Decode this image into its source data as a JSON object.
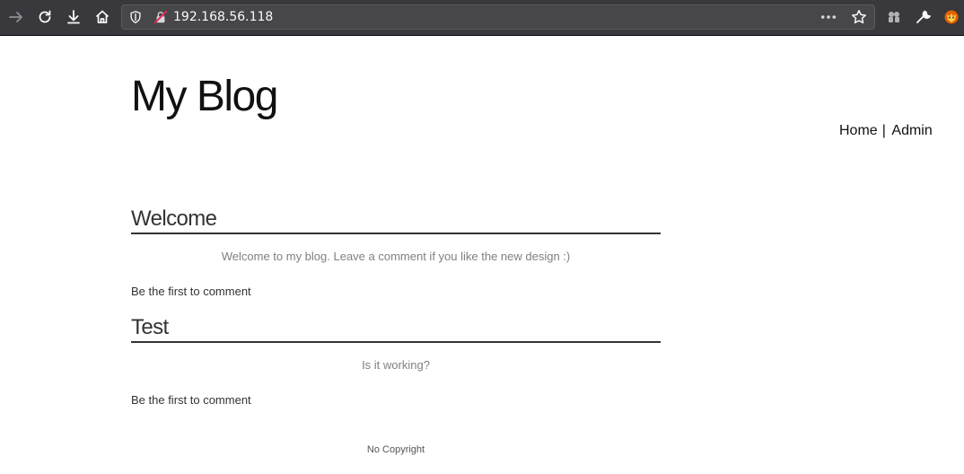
{
  "browser": {
    "url": "192.168.56.118"
  },
  "site": {
    "title": "My Blog",
    "nav": {
      "home": "Home",
      "separator": "|",
      "admin": "Admin"
    }
  },
  "posts": [
    {
      "title": "Welcome",
      "body": "Welcome to my blog. Leave a comment if you like the new design :)",
      "comments": "Be the first to comment"
    },
    {
      "title": "Test",
      "body": "Is it working?",
      "comments": "Be the first to comment"
    }
  ],
  "footer": {
    "text": "No Copyright"
  },
  "icons": {
    "back": "arrow-right-icon",
    "reload": "reload-icon",
    "downloads": "download-icon",
    "home": "home-icon",
    "tracking": "shield-icon",
    "insecure": "insecure-lock-icon",
    "page_actions": "more-dots-icon",
    "bookmark": "star-icon",
    "extension": "extension-icon",
    "devtools": "wrench-icon",
    "addon": "fox-icon"
  }
}
